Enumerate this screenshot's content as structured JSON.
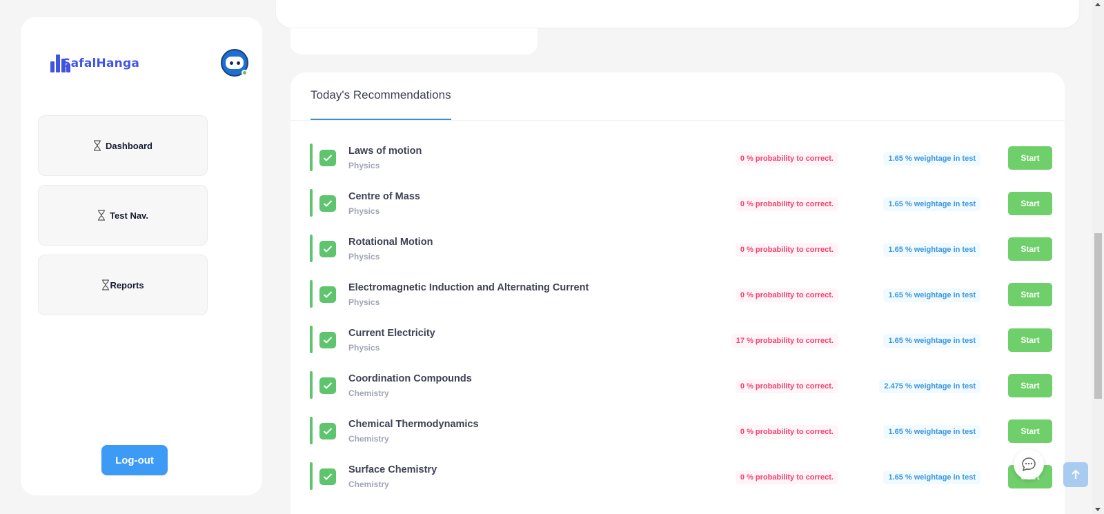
{
  "brand": {
    "name": "SafalHanga",
    "accent": "#3f55e6"
  },
  "sidebar": {
    "items": [
      {
        "label": "Dashboard",
        "icon": "hourglass-icon"
      },
      {
        "label": "Test Nav.",
        "icon": "hourglass-icon"
      },
      {
        "label": "Reports",
        "icon": "hourglass-icon"
      }
    ],
    "logout_label": "Log-out"
  },
  "recommendations": {
    "title": "Today's Recommendations",
    "start_label": "Start",
    "rows": [
      {
        "topic": "Laws of motion",
        "subject": "Physics",
        "probability": "0 % probability to correct.",
        "weightage": "1.65 % weightage in test"
      },
      {
        "topic": "Centre of Mass",
        "subject": "Physics",
        "probability": "0 % probability to correct.",
        "weightage": "1.65 % weightage in test"
      },
      {
        "topic": "Rotational Motion",
        "subject": "Physics",
        "probability": "0 % probability to correct.",
        "weightage": "1.65 % weightage in test"
      },
      {
        "topic": "Electromagnetic Induction and Alternating Current",
        "subject": "Physics",
        "probability": "0 % probability to correct.",
        "weightage": "1.65 % weightage in test"
      },
      {
        "topic": "Current Electricity",
        "subject": "Physics",
        "probability": "17 % probability to correct.",
        "weightage": "1.65 % weightage in test"
      },
      {
        "topic": "Coordination Compounds",
        "subject": "Chemistry",
        "probability": "0 % probability to correct.",
        "weightage": "2.475 % weightage in test"
      },
      {
        "topic": "Chemical Thermodynamics",
        "subject": "Chemistry",
        "probability": "0 % probability to correct.",
        "weightage": "1.65 % weightage in test"
      },
      {
        "topic": "Surface Chemistry",
        "subject": "Chemistry",
        "probability": "0 % probability to correct.",
        "weightage": "1.65 % weightage in test"
      }
    ]
  },
  "colors": {
    "success": "#5ec46d",
    "danger": "#f1416c",
    "info": "#3b96dd",
    "primary": "#3d9bf5"
  },
  "floating": {
    "chat_icon": "chat-bubble-icon",
    "scroll_top_icon": "arrow-up-icon"
  }
}
